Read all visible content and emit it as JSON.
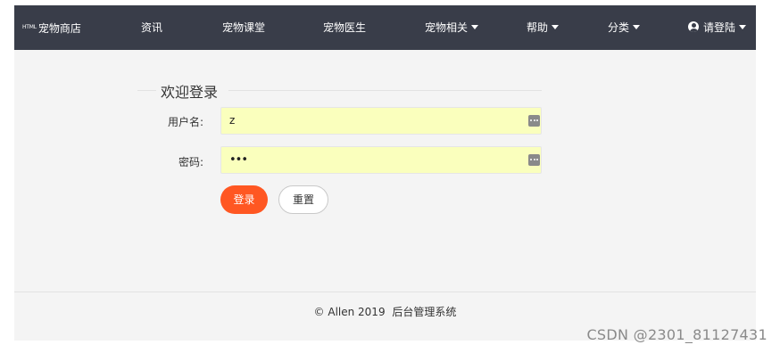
{
  "nav": {
    "brand_badge": "HTML",
    "brand": "宠物商店",
    "items": [
      {
        "label": "资讯"
      },
      {
        "label": "宠物课堂"
      },
      {
        "label": "宠物医生"
      },
      {
        "label": "宠物相关"
      },
      {
        "label": "帮助"
      },
      {
        "label": "分类"
      }
    ],
    "user": "请登陆"
  },
  "form": {
    "legend": "欢迎登录",
    "username_label": "用户名:",
    "username_value": "z",
    "password_label": "密码:",
    "password_value": "•••",
    "login_label": "登录",
    "reset_label": "重置"
  },
  "footer": {
    "copyright": "© Allen 2019",
    "system_name": "后台管理系统"
  },
  "watermark": "CSDN @2301_81127431",
  "colors": {
    "nav_bg": "#393d49",
    "primary": "#ff5722",
    "autofill": "#faffbd",
    "page_bg": "#f4f4f4"
  },
  "icons": [
    "caret-down-icon",
    "user-circle-icon",
    "password-manager-key-icon"
  ]
}
